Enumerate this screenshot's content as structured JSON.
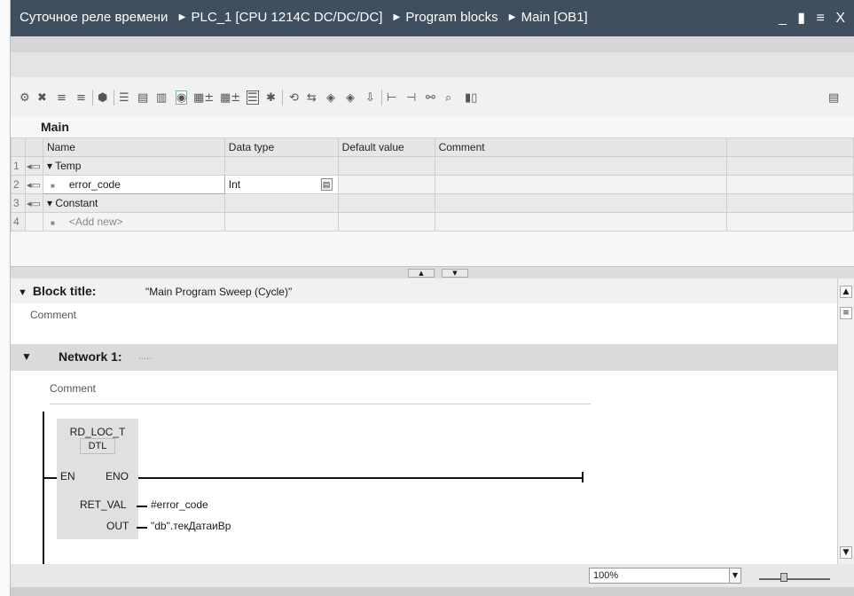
{
  "titlebar": {
    "crumbs": [
      "Суточное реле времени",
      "PLC_1 [CPU 1214C DC/DC/DC]",
      "Program blocks",
      "Main [OB1]"
    ],
    "window_buttons": "_ ▮ ≡ X"
  },
  "interface": {
    "block_name": "Main",
    "columns": [
      "Name",
      "Data type",
      "Default value",
      "Comment"
    ],
    "rows": [
      {
        "num": "1",
        "name": "▾ Temp",
        "type": "",
        "default": "",
        "comment": ""
      },
      {
        "num": "2",
        "name": "error_code",
        "type": "Int",
        "default": "",
        "comment": ""
      },
      {
        "num": "3",
        "name": "▾ Constant",
        "type": "",
        "default": "",
        "comment": ""
      },
      {
        "num": "4",
        "name": "<Add new>",
        "type": "",
        "default": "",
        "comment": ""
      }
    ]
  },
  "block": {
    "title_label": "Block title:",
    "title_value": "\"Main Program Sweep (Cycle)\"",
    "comment": "Comment",
    "network_label": "Network 1:",
    "network_dots": ".....",
    "network_comment": "Comment"
  },
  "fbd": {
    "name": "RD_LOC_T",
    "type": "DTL",
    "en": "EN",
    "eno": "ENO",
    "ret_val": "RET_VAL",
    "ret_val_operand": "#error_code",
    "out": "OUT",
    "out_operand": "\"db\".текДатаиВр"
  },
  "status": {
    "zoom": "100%"
  }
}
